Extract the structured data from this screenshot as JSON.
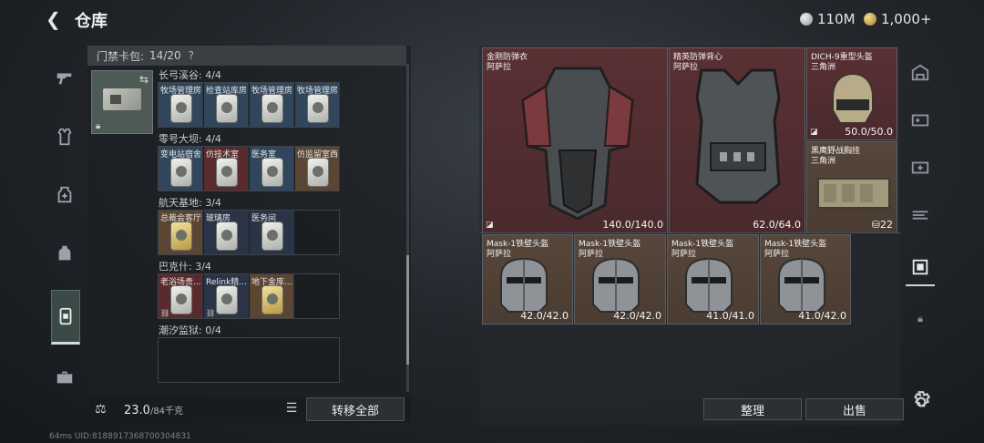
{
  "header": {
    "back_glyph": "❮",
    "title": "仓库",
    "currency": [
      {
        "icon": "silver-coin-icon",
        "value": "110M",
        "color": "#bfc4c8"
      },
      {
        "icon": "gold-coin-icon",
        "value": "1,000+",
        "color": "#d7b56a"
      }
    ]
  },
  "left_rail": {
    "items": [
      {
        "icon": "pistol-icon",
        "active": false
      },
      {
        "icon": "armor-vest-icon",
        "active": false
      },
      {
        "icon": "medkit-icon",
        "active": false
      },
      {
        "icon": "backpack-icon",
        "active": false
      },
      {
        "icon": "keycard-case-icon",
        "active": true
      },
      {
        "icon": "toolbox-icon",
        "active": false
      }
    ]
  },
  "key_panel": {
    "header_label": "门禁卡包:",
    "header_count": "14/20",
    "help": "?",
    "groups": [
      {
        "label": "长弓溪谷: 4/4",
        "slots": [
          {
            "name": "牧场管理房",
            "color": "blue",
            "gold": false,
            "locked": false
          },
          {
            "name": "检查站库房",
            "color": "blue",
            "gold": false,
            "locked": false
          },
          {
            "name": "牧场管理房",
            "color": "blue",
            "gold": false,
            "locked": false
          },
          {
            "name": "牧场管理房",
            "color": "blue",
            "gold": false,
            "locked": false
          }
        ]
      },
      {
        "label": "零号大坝: 4/4",
        "slots": [
          {
            "name": "变电站宿舍",
            "color": "blue",
            "gold": false,
            "locked": false
          },
          {
            "name": "仿技术室",
            "color": "red",
            "gold": false,
            "locked": false
          },
          {
            "name": "医务室",
            "color": "blue",
            "gold": false,
            "locked": false
          },
          {
            "name": "仿监留室西",
            "color": "tan",
            "gold": false,
            "locked": false
          }
        ]
      },
      {
        "label": "航天基地: 3/4",
        "slots": [
          {
            "name": "总裁会客厅",
            "color": "tan",
            "gold": true,
            "locked": false
          },
          {
            "name": "玻璃房",
            "color": "navy",
            "gold": false,
            "locked": false
          },
          {
            "name": "医务间",
            "color": "navy",
            "gold": false,
            "locked": false
          }
        ]
      },
      {
        "label": "巴克什: 3/4",
        "slots": [
          {
            "name": "老浴场贵...",
            "color": "red",
            "gold": false,
            "locked": true
          },
          {
            "name": "Relink精...",
            "color": "navy",
            "gold": false,
            "locked": true
          },
          {
            "name": "地下金库...",
            "color": "tan",
            "gold": true,
            "locked": false
          }
        ]
      },
      {
        "label": "潮汐监狱: 0/4",
        "slots": []
      }
    ],
    "weight": "23.0",
    "weight_max": "/84千克",
    "transfer_all": "转移全部"
  },
  "storage": {
    "items": [
      {
        "line1": "金刚防弹衣",
        "line2": "阿萨拉",
        "durability": "140.0/140.0"
      },
      {
        "line1": "精英防弹背心",
        "line2": "阿萨拉",
        "durability": "62.0/64.0"
      },
      {
        "line1": "DICH-9重型头盔",
        "line2": "三角洲",
        "durability": "50.0/50.0"
      },
      {
        "line1": "黑鹰野战胸挂",
        "line2": "三角洲",
        "durability": "22"
      },
      {
        "line1": "Mask-1铁壁头盔",
        "line2": "阿萨拉",
        "durability": "42.0/42.0"
      },
      {
        "line1": "Mask-1铁壁头盔",
        "line2": "阿萨拉",
        "durability": "42.0/42.0"
      },
      {
        "line1": "Mask-1铁壁头盔",
        "line2": "阿萨拉",
        "durability": "41.0/41.0"
      },
      {
        "line1": "Mask-1铁壁头盔",
        "line2": "阿萨拉",
        "durability": "41.0/42.0"
      }
    ],
    "sort": "整理",
    "sell": "出售"
  },
  "right_rail": {
    "items": [
      "vault-icon",
      "id-card-icon",
      "add-storage-icon",
      "weapon-rack-icon",
      "armor-stand-icon",
      "lock-icon"
    ]
  },
  "status": "64ms  UID:8188917368700304831"
}
